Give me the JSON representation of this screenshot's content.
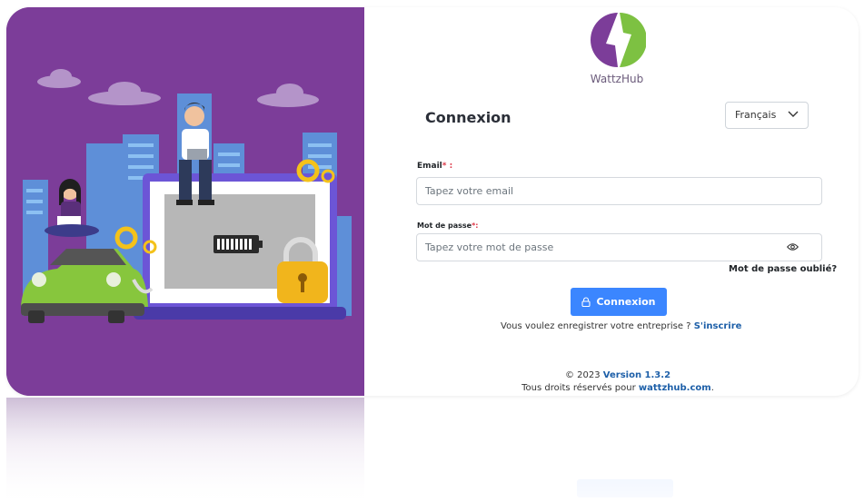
{
  "brand": {
    "name": "WattzHub",
    "colors": {
      "green": "#7dc142",
      "purple": "#7c3d99"
    }
  },
  "language": {
    "selected": "Français",
    "icon": "chevron-down-icon"
  },
  "form": {
    "title": "Connexion",
    "email_label": "Email",
    "email_req": "* :",
    "email_placeholder": "Tapez votre email",
    "password_label": "Mot de passe",
    "password_req": "*:",
    "password_placeholder": "Tapez votre mot de passe",
    "forgot_password": "Mot de passe oublié?",
    "submit_label": "Connexion",
    "submit_icon": "lock-icon",
    "accent": "#3b86ff"
  },
  "register": {
    "prompt": "Vous voulez enregistrer votre entreprise ?",
    "link": "S'inscrire"
  },
  "footer": {
    "copyright": "© 2023",
    "version": "Version 1.3.2",
    "rights": "Tous droits réservés pour",
    "domain": "wattzhub.com",
    "rights_end": "."
  }
}
